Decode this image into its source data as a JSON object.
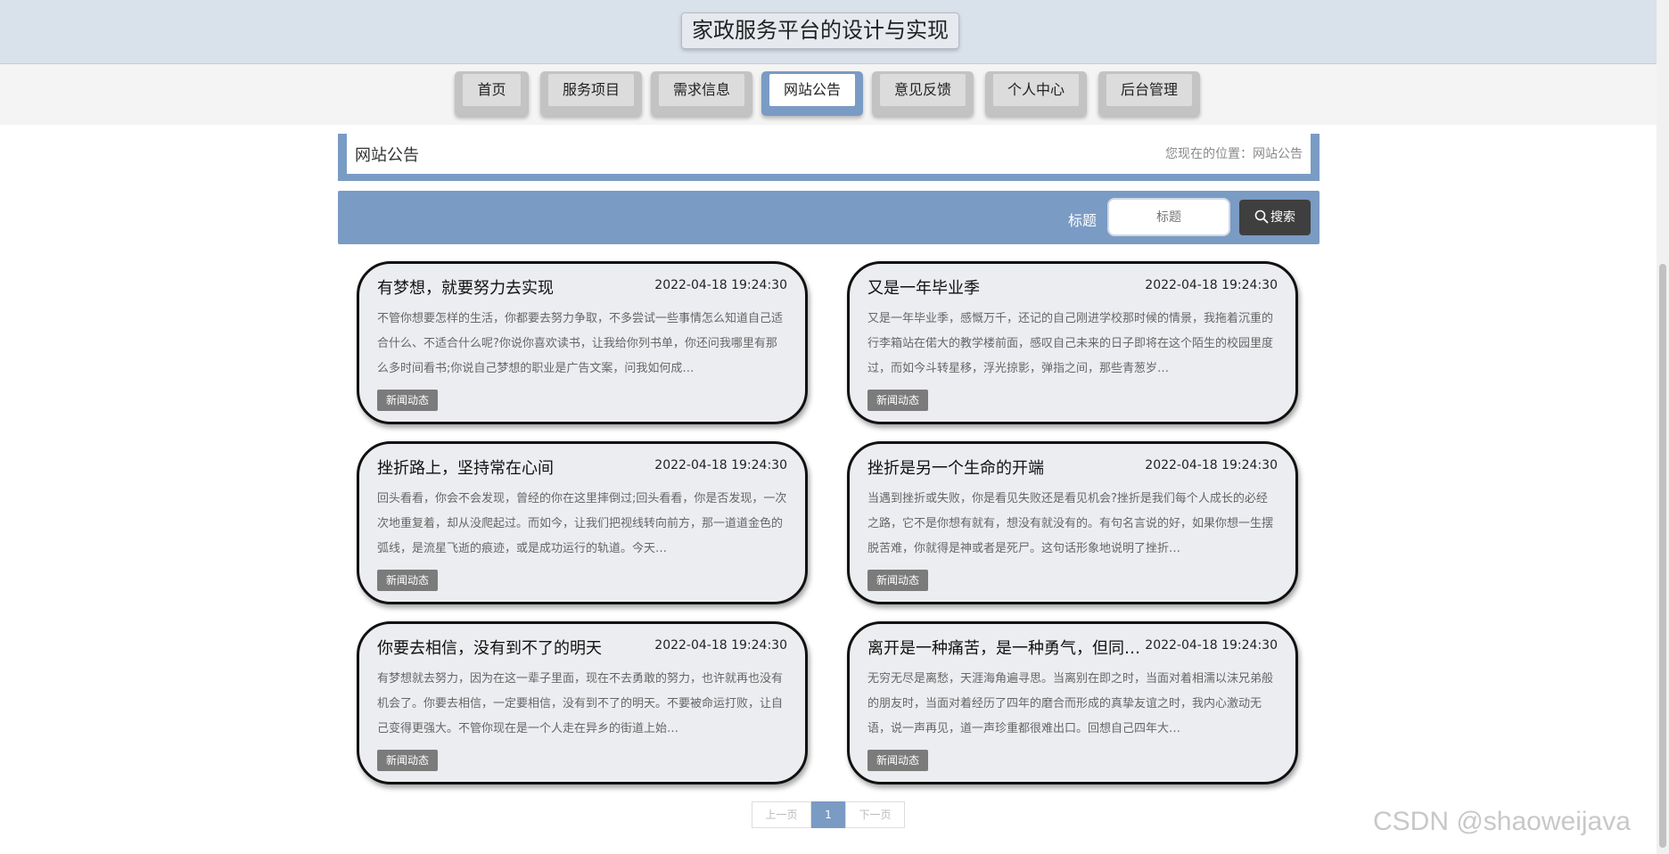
{
  "site": {
    "title": "家政服务平台的设计与实现"
  },
  "nav": {
    "items": [
      {
        "label": "首页"
      },
      {
        "label": "服务项目"
      },
      {
        "label": "需求信息"
      },
      {
        "label": "网站公告"
      },
      {
        "label": "意见反馈"
      },
      {
        "label": "个人中心"
      },
      {
        "label": "后台管理"
      }
    ],
    "active": "网站公告"
  },
  "breadcrumb": {
    "title": "网站公告",
    "location": "您现在的位置：网站公告"
  },
  "search": {
    "label": "标题",
    "placeholder": "标题",
    "button": "搜索"
  },
  "notices": [
    {
      "title": "有梦想，就要努力去实现",
      "date": "2022-04-18 19:24:30",
      "summary": "不管你想要怎样的生活，你都要去努力争取，不多尝试一些事情怎么知道自己适合什么、不适合什么呢?你说你喜欢读书，让我给你列书单，你还问我哪里有那么多时间看书;你说自己梦想的职业是广告文案，问我如何成…",
      "tag": "新闻动态"
    },
    {
      "title": "又是一年毕业季",
      "date": "2022-04-18 19:24:30",
      "summary": "又是一年毕业季，感慨万千，还记的自己刚进学校那时候的情景，我拖着沉重的行李箱站在偌大的教学楼前面，感叹自己未来的日子即将在这个陌生的校园里度过，而如今斗转星移，浮光掠影，弹指之间，那些青葱岁…",
      "tag": "新闻动态"
    },
    {
      "title": "挫折路上，坚持常在心间",
      "date": "2022-04-18 19:24:30",
      "summary": "回头看看，你会不会发现，曾经的你在这里摔倒过;回头看看，你是否发现，一次次地重复着，却从没爬起过。而如今，让我们把视线转向前方，那一道道金色的弧线，是流星飞逝的痕迹，或是成功运行的轨道。今天…",
      "tag": "新闻动态"
    },
    {
      "title": "挫折是另一个生命的开端",
      "date": "2022-04-18 19:24:30",
      "summary": "当遇到挫折或失败，你是看见失败还是看见机会?挫折是我们每个人成长的必经之路，它不是你想有就有，想没有就没有的。有句名言说的好，如果你想一生摆脱苦难，你就得是神或者是死尸。这句话形象地说明了挫折…",
      "tag": "新闻动态"
    },
    {
      "title": "你要去相信，没有到不了的明天",
      "date": "2022-04-18 19:24:30",
      "summary": "有梦想就去努力，因为在这一辈子里面，现在不去勇敢的努力，也许就再也没有机会了。你要去相信，一定要相信，没有到不了的明天。不要被命运打败，让自己变得更强大。不管你现在是一个人走在异乡的街道上始…",
      "tag": "新闻动态"
    },
    {
      "title": "离开是一种痛苦，是一种勇气，但同样…",
      "date": "2022-04-18 19:24:30",
      "summary": "无穷无尽是离愁，天涯海角遍寻思。当离别在即之时，当面对着相濡以沫兄弟般的朋友时，当面对着经历了四年的磨合而形成的真挚友谊之时，我内心激动无语，说一声再见，道一声珍重都很难出口。回想自己四年大…",
      "tag": "新闻动态"
    }
  ],
  "pagination": {
    "prev": "上一页",
    "current": "1",
    "next": "下一页"
  },
  "watermark": "CSDN @shaoweijava",
  "colors": {
    "accent": "#7a9bc4",
    "header": "#d9e1eb",
    "button_dark": "#3f3f3f",
    "tag": "#7b7b7b"
  }
}
